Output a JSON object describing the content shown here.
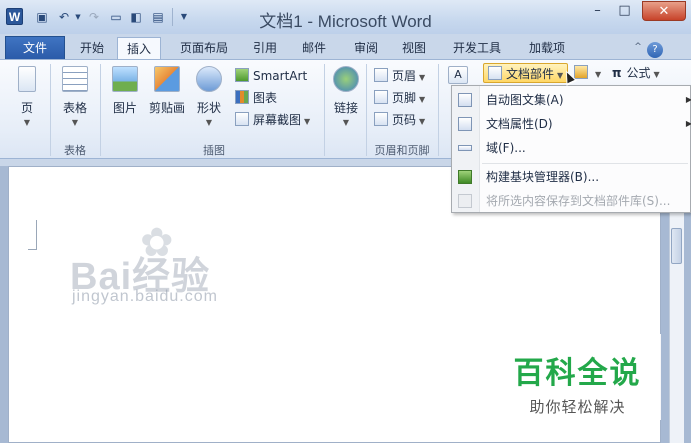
{
  "titlebar": {
    "title": "文档1 - Microsoft Word",
    "app_icon": "W",
    "qat_icons": [
      "save-icon",
      "undo-icon",
      "redo-icon",
      "open-icon",
      "print-preview-icon",
      "quick-print-icon",
      "customize-qat-icon"
    ],
    "minimize": "–",
    "restore": "□",
    "close": "✕"
  },
  "tabs": {
    "file": "文件",
    "items": [
      "开始",
      "插入",
      "页面布局",
      "引用",
      "邮件",
      "审阅",
      "视图",
      "开发工具",
      "加载项"
    ],
    "active": "插入",
    "help": "?",
    "collapse": "^"
  },
  "ribbon": {
    "pages": {
      "label": "页",
      "group": "页"
    },
    "table": {
      "label": "表格",
      "group": "表格"
    },
    "illustrations": {
      "group": "插图",
      "picture": "图片",
      "clipart": "剪贴画",
      "shapes": "形状",
      "smartart": "SmartArt",
      "chart": "图表",
      "screenshot": "屏幕截图"
    },
    "links": {
      "label": "链接"
    },
    "header_footer": {
      "group": "页眉和页脚",
      "header": "页眉",
      "footer": "页脚",
      "page_number": "页码"
    },
    "text": {
      "textbox_partial": "文",
      "docparts": "文档部件",
      "equation": "公式",
      "pi": "π"
    }
  },
  "menu": {
    "items": [
      {
        "label": "自动图文集(A)",
        "submenu": true,
        "enabled": true,
        "icon": "autotext-icon"
      },
      {
        "label": "文档属性(D)",
        "submenu": true,
        "enabled": true,
        "icon": "document-property-icon"
      },
      {
        "label": "域(F)...",
        "submenu": false,
        "enabled": true,
        "icon": "field-icon"
      },
      {
        "label": "构建基块管理器(B)...",
        "submenu": false,
        "enabled": true,
        "icon": "building-blocks-icon"
      },
      {
        "label": "将所选内容保存到文档部件库(S)...",
        "submenu": false,
        "enabled": false,
        "icon": "save-selection-icon"
      }
    ],
    "arrow": "▶"
  },
  "watermark": {
    "baidu": "Bai经验",
    "du": "du",
    "url": "jingyan.baidu.com",
    "brand_title": "百科全说",
    "brand_sub": "助你轻松解决"
  }
}
